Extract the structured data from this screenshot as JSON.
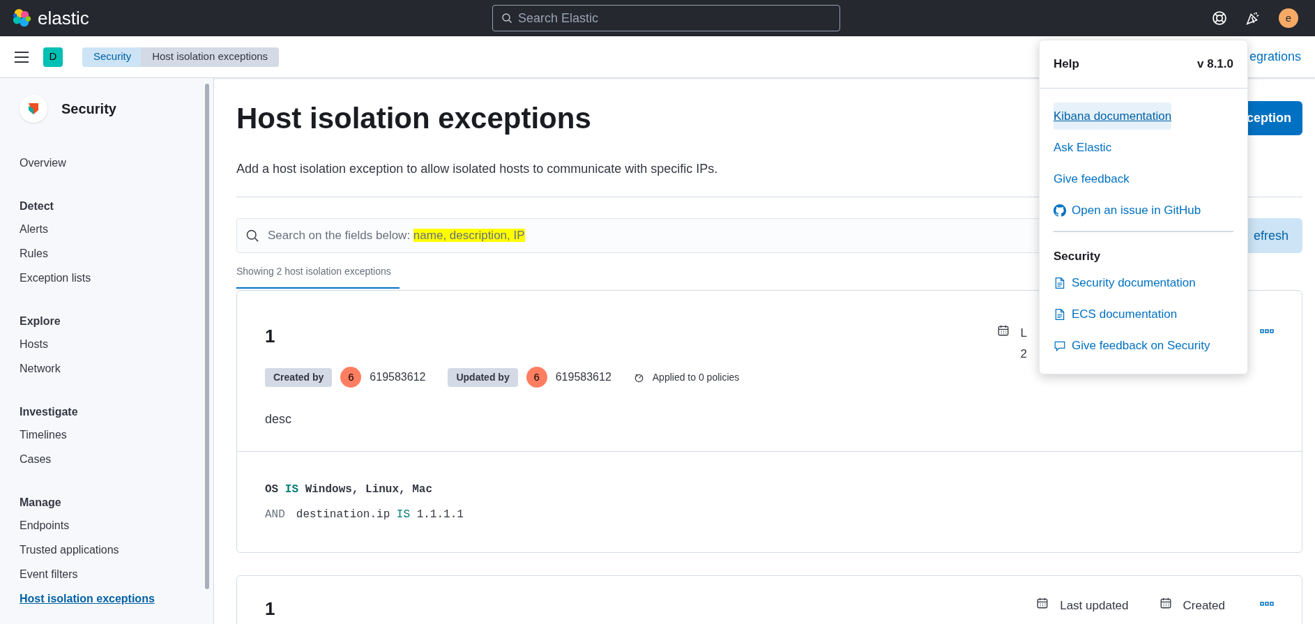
{
  "header": {
    "brand": "elastic",
    "search": {
      "placeholder": "Search Elastic"
    },
    "avatar": "e"
  },
  "breadcrumbs": {
    "space": "D",
    "items": [
      {
        "label": "Security",
        "selected": false
      },
      {
        "label": "Host isolation exceptions",
        "selected": true
      }
    ],
    "link": "egrations"
  },
  "sidebar": {
    "app": "Security",
    "items": [
      {
        "label": "Overview",
        "selected": false
      }
    ],
    "groups": [
      {
        "title": "Detect",
        "items": [
          {
            "label": "Alerts",
            "selected": false
          },
          {
            "label": "Rules",
            "selected": false
          },
          {
            "label": "Exception lists",
            "selected": false
          }
        ]
      },
      {
        "title": "Explore",
        "items": [
          {
            "label": "Hosts",
            "selected": false
          },
          {
            "label": "Network",
            "selected": false
          }
        ]
      },
      {
        "title": "Investigate",
        "items": [
          {
            "label": "Timelines",
            "selected": false
          },
          {
            "label": "Cases",
            "selected": false
          }
        ]
      },
      {
        "title": "Manage",
        "items": [
          {
            "label": "Endpoints",
            "selected": false
          },
          {
            "label": "Trusted applications",
            "selected": false
          },
          {
            "label": "Event filters",
            "selected": false
          },
          {
            "label": "Host isolation exceptions",
            "selected": true
          }
        ]
      }
    ]
  },
  "page": {
    "title": "Host isolation exceptions",
    "add_button": "ception",
    "description": "Add a host isolation exception to allow isolated hosts to communicate with specific IPs.",
    "search": {
      "placeholder": "Search on the fields below: ",
      "highlight": "name, description, IP"
    },
    "refresh_button": "efresh",
    "count": "Showing 2 host isolation exceptions"
  },
  "cards": [
    {
      "name": "1",
      "meta": [
        {
          "label": "L",
          "value": "2"
        }
      ],
      "created_by_label": "Created by",
      "created_by": {
        "avatar": "6",
        "name": "619583612"
      },
      "updated_by_label": "Updated by",
      "updated_by": {
        "avatar": "6",
        "name": "619583612"
      },
      "policies": "Applied to 0 policies",
      "description": "desc",
      "conditions": [
        {
          "field": "OS",
          "operator": "IS",
          "value": "Windows, Linux, Mac"
        },
        {
          "conjunction": "AND",
          "field": "destination.ip",
          "operator": "IS",
          "value": "1.1.1.1"
        }
      ]
    },
    {
      "name": "1",
      "meta": [
        {
          "label": "Last updated"
        },
        {
          "label": "Created"
        }
      ]
    }
  ],
  "help_popover": {
    "title": "Help",
    "version": "v 8.1.0",
    "links": [
      {
        "label": "Kibana documentation",
        "kind": "plain",
        "selected": true
      },
      {
        "label": "Ask Elastic",
        "kind": "plain",
        "selected": false
      },
      {
        "label": "Give feedback",
        "kind": "plain",
        "selected": false
      },
      {
        "label": "Open an issue in GitHub",
        "kind": "github",
        "selected": false
      }
    ],
    "section_title": "Security",
    "section_links": [
      {
        "label": "Security documentation",
        "kind": "document",
        "selected": false
      },
      {
        "label": "ECS documentation",
        "kind": "document",
        "selected": false
      },
      {
        "label": "Give feedback on Security",
        "kind": "comment",
        "selected": false
      }
    ]
  }
}
